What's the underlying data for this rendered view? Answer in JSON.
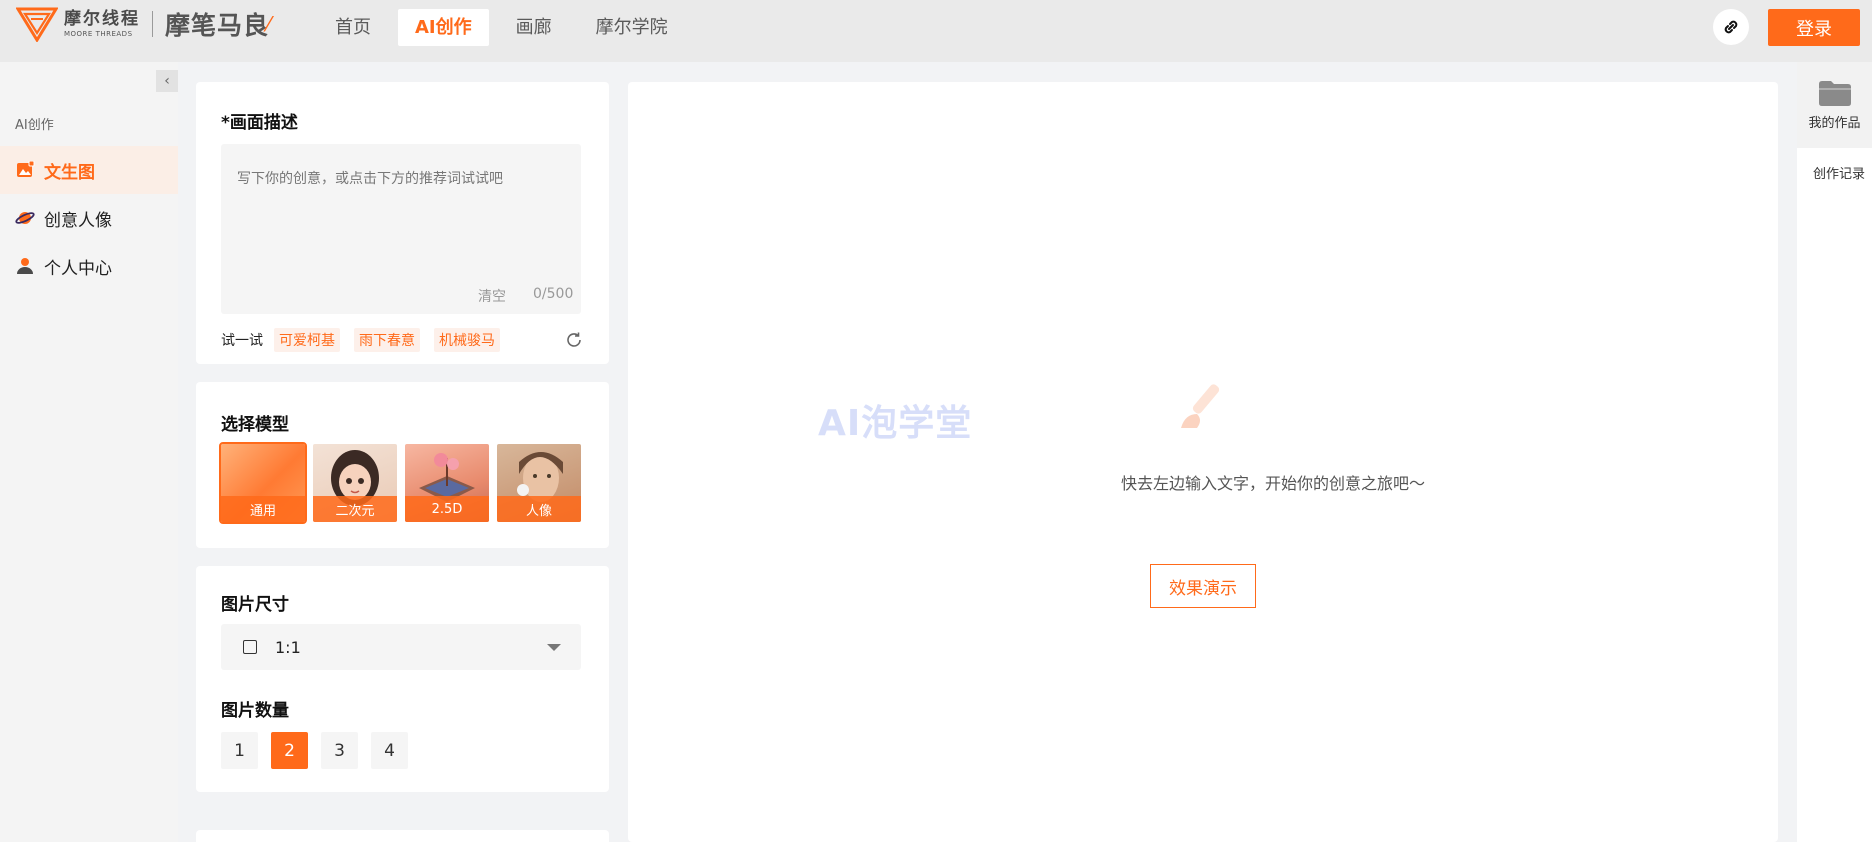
{
  "header": {
    "logo_cn": "摩尔线程",
    "logo_en": "MOORE THREADS",
    "brand": "摩笔马良",
    "nav": [
      "首页",
      "AI创作",
      "画廊",
      "摩尔学院"
    ],
    "active_nav": "AI创作",
    "login_label": "登录",
    "accent_color": "#ff6a1a"
  },
  "sidebar": {
    "heading": "AI创作",
    "items": [
      {
        "label": "文生图",
        "icon": "image-edit-icon",
        "active": true
      },
      {
        "label": "创意人像",
        "icon": "planet-icon",
        "active": false
      },
      {
        "label": "个人中心",
        "icon": "user-icon",
        "active": false
      }
    ]
  },
  "prompt": {
    "title": "*画面描述",
    "placeholder": "写下你的创意，或点击下方的推荐词试试吧",
    "clear_label": "清空",
    "counter": "0/500",
    "try_label": "试一试",
    "tags": [
      "可爱柯基",
      "雨下春意",
      "机械骏马"
    ]
  },
  "model": {
    "title": "选择模型",
    "options": [
      "通用",
      "二次元",
      "2.5D",
      "人像"
    ],
    "selected": "通用"
  },
  "size": {
    "title": "图片尺寸",
    "value": "1:1"
  },
  "count": {
    "title": "图片数量",
    "options": [
      "1",
      "2",
      "3",
      "4"
    ],
    "selected": "2"
  },
  "canvas": {
    "watermark": "AI泡学堂",
    "hint": "快去左边输入文字，开始你的创意之旅吧～",
    "demo_label": "效果演示"
  },
  "right_bar": {
    "works_label": "我的作品",
    "record_label": "创作记录"
  }
}
